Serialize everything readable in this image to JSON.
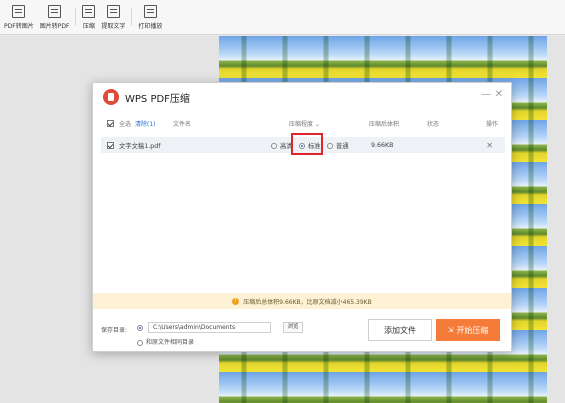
{
  "toolbar": {
    "items": [
      {
        "label": "PDF转图片",
        "icon": "pdf-to-image-icon"
      },
      {
        "label": "图片转PDF",
        "icon": "image-to-pdf-icon"
      },
      {
        "label": "压缩",
        "icon": "compress-icon"
      },
      {
        "label": "提取文字",
        "icon": "extract-text-icon"
      },
      {
        "label": "打印播放",
        "icon": "print-play-icon"
      }
    ]
  },
  "dialog": {
    "title": "WPS PDF压缩",
    "minimize": "—",
    "close": "✕",
    "header": {
      "select_all": "全选",
      "clear": "清除(1)",
      "filename": "文件名",
      "level": "压缩程度 ⌄",
      "size": "压缩后体积",
      "status": "状态",
      "action": "操作"
    },
    "row": {
      "filename": "文字文稿1.pdf",
      "levels": [
        "高清",
        "标准",
        "普通"
      ],
      "selected_level": "标准",
      "size": "9.66KB",
      "delete": "✕"
    },
    "banner": "压缩后总体积9.66KB，比原文档减小465.39KB",
    "footer": {
      "save_label": "保存目录:",
      "path": "C:\\Users\\admin\\Documents",
      "browse": "浏览",
      "same_dir": "和原文件相同目录",
      "add_file": "添加文件",
      "start": "开始压缩"
    },
    "colors": {
      "accent": "#f57c38",
      "highlight": "#e0262a",
      "logo": "#e04a3a"
    }
  }
}
